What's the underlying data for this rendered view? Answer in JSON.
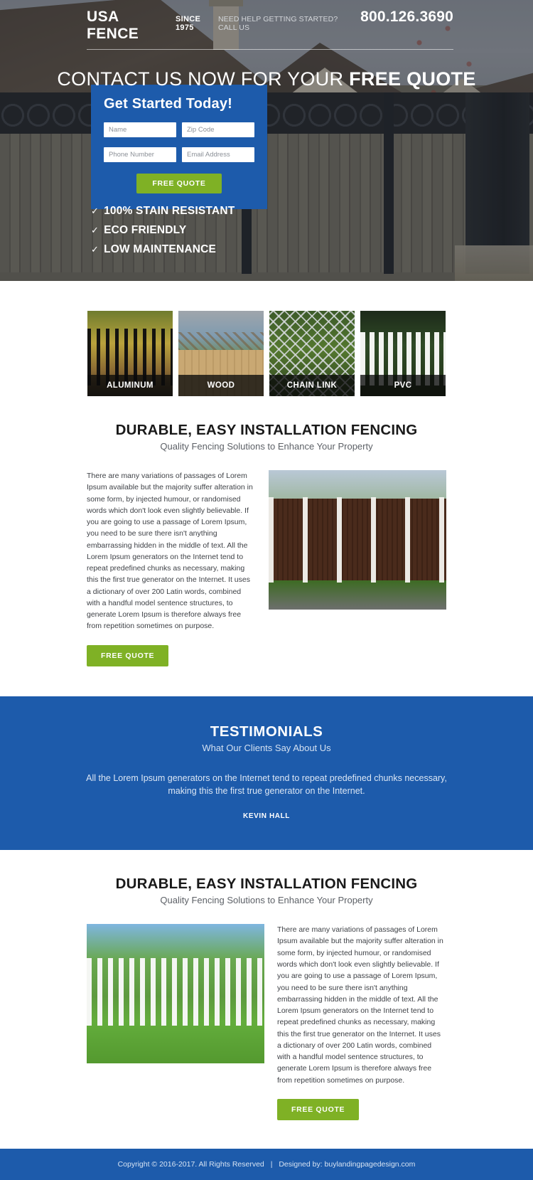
{
  "header": {
    "brand": "USA FENCE",
    "since": "SINCE 1975",
    "need_help": "NEED HELP GETTING STARTED? CALL US",
    "phone": "800.126.3690"
  },
  "hero": {
    "headline_light": "CONTACT US NOW FOR YOUR ",
    "headline_bold": "FREE QUOTE",
    "form": {
      "title": "Get Started Today!",
      "name_placeholder": "Name",
      "zip_placeholder": "Zip Code",
      "phone_placeholder": "Phone Number",
      "email_placeholder": "Email Address",
      "name_value": "",
      "zip_value": "",
      "phone_value": "",
      "email_value": "",
      "submit_label": "FREE QUOTE"
    },
    "benefits": [
      {
        "tick": "✓",
        "label": "100% STAIN RESISTANT"
      },
      {
        "tick": "✓",
        "label": "ECO FRIENDLY"
      },
      {
        "tick": "✓",
        "label": "LOW MAINTENANCE"
      }
    ]
  },
  "categories": [
    {
      "label": "ALUMINUM",
      "image": "aluminum-fence-photo"
    },
    {
      "label": "WOOD",
      "image": "wood-fence-photo"
    },
    {
      "label": "CHAIN LINK",
      "image": "chain-link-fence-photo"
    },
    {
      "label": "PVC",
      "image": "pvc-fence-photo"
    }
  ],
  "section_one": {
    "title": "DURABLE, EASY INSTALLATION FENCING",
    "subtitle": "Quality Fencing Solutions to Enhance Your Property",
    "body": "There are many variations of passages of Lorem Ipsum available but the majority suffer alteration in some form, by injected humour, or randomised words which don't look even slightly believable. If you are going to use a passage of Lorem Ipsum, you need to be sure there isn't anything embarrassing hidden in the middle of text. All the Lorem Ipsum generators on the Internet tend to repeat predefined chunks as necessary, making this the first true generator on the Internet. It uses a dictionary of over 200 Latin words, combined with a handful model sentence structures, to generate Lorem Ipsum is therefore always free from repetition sometimes on purpose.",
    "button_label": "FREE QUOTE",
    "image": "brown-fence-with-white-posts-photo"
  },
  "testimonials": {
    "title": "TESTIMONIALS",
    "subtitle": "What Our Clients Say About Us",
    "quote": "All the Lorem Ipsum generators on the Internet tend to repeat predefined chunks necessary, making this the first true generator on the Internet.",
    "author": "KEVIN HALL"
  },
  "section_two": {
    "title": "DURABLE, EASY INSTALLATION FENCING",
    "subtitle": "Quality Fencing Solutions to Enhance Your Property",
    "body": "There are many variations of passages of Lorem Ipsum available but the majority suffer alteration in some form, by injected humour, or randomised words which don't look even slightly believable. If you are going to use a passage of Lorem Ipsum, you need to be sure there isn't anything embarrassing hidden in the middle of text. All the Lorem Ipsum generators on the Internet tend to repeat predefined chunks as necessary, making this the first true generator on the Internet. It uses a dictionary of over 200 Latin words, combined with a handful model sentence structures, to generate Lorem Ipsum is therefore always free from repetition sometimes on purpose.",
    "button_label": "FREE QUOTE",
    "image": "white-picket-fence-photo"
  },
  "footer": {
    "copyright": "Copyright © 2016-2017. All Rights Reserved",
    "separator": "|",
    "designed_by": "Designed by: buylandingpagedesign.com"
  },
  "colors": {
    "brand_blue": "#1d5bab",
    "accent_green": "#7fb125",
    "hero_overlay": "rgba(22,26,32,.30)"
  }
}
